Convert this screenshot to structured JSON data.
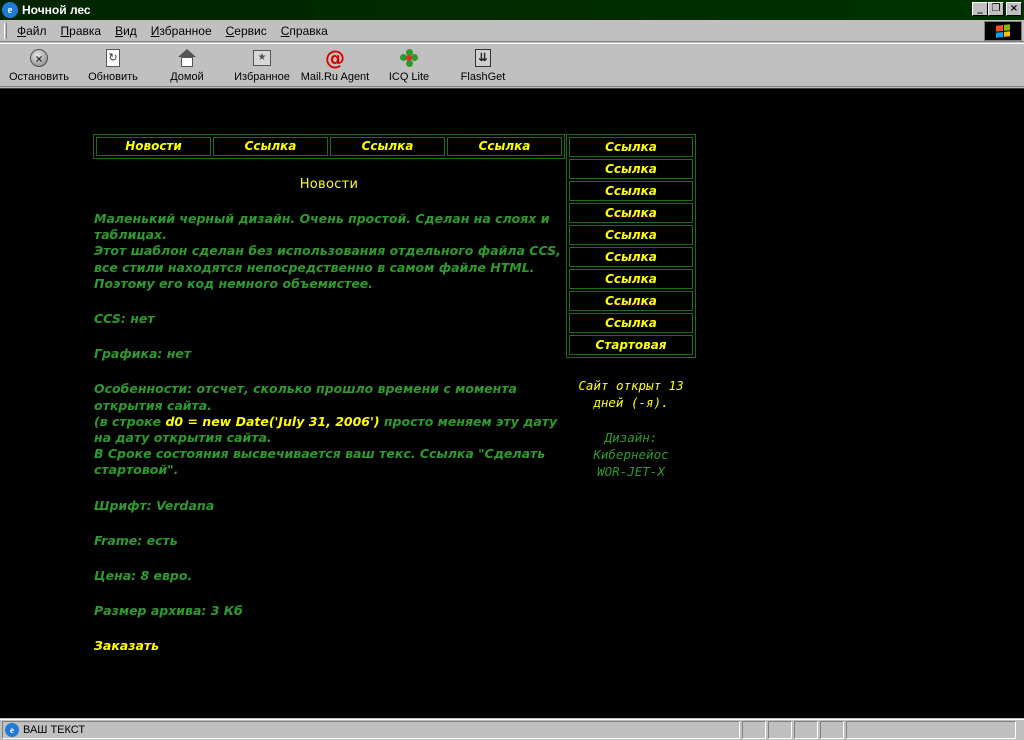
{
  "window": {
    "title": "Ночной лес"
  },
  "menu": {
    "items": [
      {
        "first": "Ф",
        "rest": "айл"
      },
      {
        "first": "П",
        "rest": "равка"
      },
      {
        "first": "В",
        "rest": "ид"
      },
      {
        "first": "И",
        "rest": "збранное"
      },
      {
        "first": "С",
        "rest": "ервис"
      },
      {
        "first": "С",
        "rest": "правка"
      }
    ]
  },
  "toolbar": {
    "stop": "Остановить",
    "refresh": "Обновить",
    "home": "Домой",
    "favorites": "Избранное",
    "mailru": "Mail.Ru Agent",
    "icq": "ICQ Lite",
    "flashget": "FlashGet"
  },
  "nav": {
    "top": [
      "Новости",
      "Ссылка",
      "Ссылка",
      "Ссылка"
    ],
    "side": [
      "Ссылка",
      "Ссылка",
      "Ссылка",
      "Ссылка",
      "Ссылка",
      "Ссылка",
      "Ссылка",
      "Ссылка",
      "Ссылка",
      "Стартовая"
    ]
  },
  "main": {
    "heading": "Новости",
    "p1": "Маленький черный дизайн. Очень простой. Сделан на слоях и таблицах.",
    "p2": "Этот шаблон сделан без использования отдельного файла CCS, все стили находятся непосредственно в самом файле HTML. Поэтому его код немного объемистее.",
    "css": "CCS: нет",
    "graphics": "Графика: нет",
    "features": "Особенности: отсчет, сколько прошло времени с момента открытия сайта.",
    "line_a": "(в строке ",
    "code": "d0 = new Date('July 31, 2006')",
    "line_b": " просто меняем эту дату на дату открытия сайта.",
    "status_note": "В Сроке состояния высвечивается ваш текс. Ссылка \"Сделать стартовой\".",
    "font": "Шрифт: Verdana",
    "frame": "Frame: есть",
    "price": "Цена: 8 евро.",
    "size": "Размер архива: 3 Кб",
    "order": "Заказать"
  },
  "info": {
    "opened_prefix": "Сайт открыт ",
    "days": "13",
    "opened_suffix": "дней (-я).",
    "design_label": "Дизайн:",
    "designer": "Кибернейос",
    "designer2": "WOR-JET-X"
  },
  "status": {
    "text": "ВАШ ТЕКСТ"
  }
}
